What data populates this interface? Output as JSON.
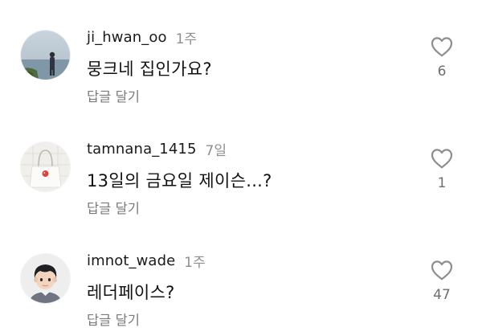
{
  "comments": [
    {
      "username": "ji_hwan_oo",
      "time": "1주",
      "text": "뭉크네 집인가요?",
      "reply_label": "답글 달기",
      "likes": "6",
      "avatar_icon": "avatar-photo-sea-person"
    },
    {
      "username": "tamnana_1415",
      "time": "7일",
      "text": "13일의 금요일 제이슨...?",
      "reply_label": "답글 달기",
      "likes": "1",
      "avatar_icon": "avatar-photo-white-bag"
    },
    {
      "username": "imnot_wade",
      "time": "1주",
      "text": "레더페이스?",
      "reply_label": "답글 달기",
      "likes": "47",
      "avatar_icon": "avatar-cartoon-boy"
    }
  ],
  "colors": {
    "text_primary": "#111111",
    "text_secondary": "#8e8e8e",
    "heart_stroke": "#8e8e8e",
    "background": "#ffffff"
  },
  "icons": {
    "like": "heart-outline-icon"
  }
}
